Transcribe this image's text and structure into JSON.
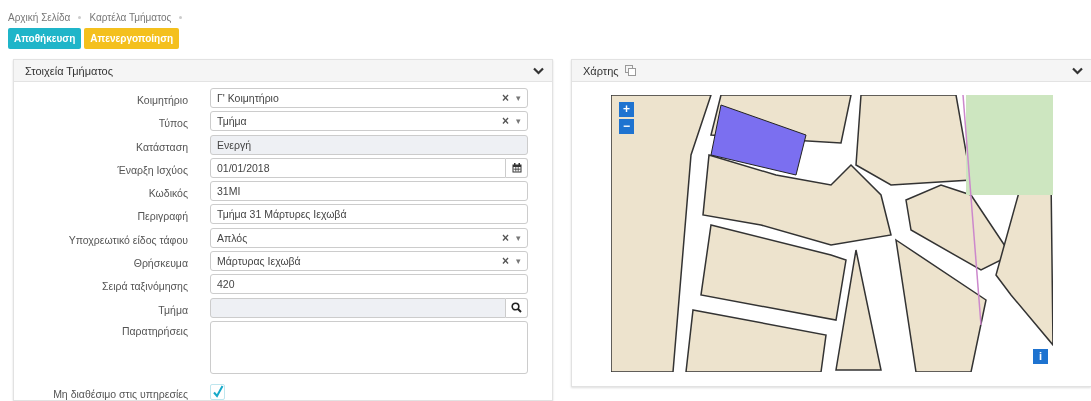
{
  "breadcrumb": [
    "Αρχική Σελίδα",
    "Καρτέλα Τμήματος"
  ],
  "actions": [
    {
      "label": "Αποθήκευση",
      "kind": "primary"
    },
    {
      "label": "Απενεργοποίηση",
      "kind": "warning"
    }
  ],
  "details_panel": {
    "title": "Στοιχεία Τμήματος",
    "fields": [
      {
        "label": "Κοιμητήριο",
        "kind": "select",
        "value": "Γ' Κοιμητήριο",
        "clear": "×",
        "caret": "▾"
      },
      {
        "label": "Τύπος",
        "kind": "select",
        "value": "Τμήμα",
        "clear": "×",
        "caret": "▾"
      },
      {
        "label": "Κατάσταση",
        "kind": "readonly",
        "value": "Ενεργή"
      },
      {
        "label": "Έναρξη Ισχύος",
        "kind": "date",
        "value": "01/01/2018"
      },
      {
        "label": "Κωδικός",
        "kind": "text",
        "value": "31MI"
      },
      {
        "label": "Περιγραφή",
        "kind": "text",
        "value": "Τμήμα 31 Μάρτυρες Ιεχωβά"
      },
      {
        "label": "Υποχρεωτικό είδος τάφου",
        "kind": "select",
        "value": "Απλός",
        "clear": "×",
        "caret": "▾"
      },
      {
        "label": "Θρήσκευμα",
        "kind": "select",
        "value": "Μάρτυρας Ιεχωβά",
        "clear": "×",
        "caret": "▾"
      },
      {
        "label": "Σειρά ταξινόμησης",
        "kind": "text",
        "value": "420"
      },
      {
        "label": "Τμήμα",
        "kind": "lookup"
      },
      {
        "label": "Παρατηρήσεις",
        "kind": "textarea"
      },
      {
        "label": "Μη διαθέσιμο στις υπηρεσίες",
        "kind": "checkbox",
        "checked": true
      }
    ]
  },
  "map_panel": {
    "title": "Χάρτης",
    "zoom_in": "+",
    "zoom_out": "−",
    "info": "i"
  }
}
